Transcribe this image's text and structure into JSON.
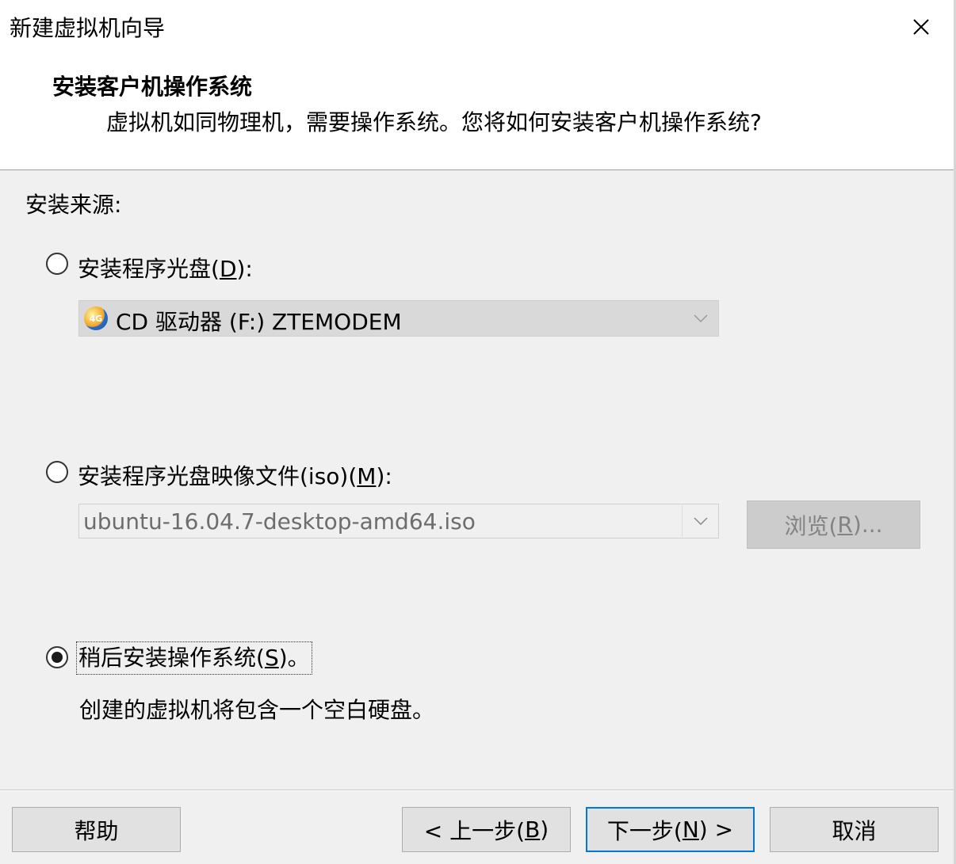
{
  "window": {
    "title": "新建虚拟机向导"
  },
  "header": {
    "title": "安装客户机操作系统",
    "subtitle": "虚拟机如同物理机，需要操作系统。您将如何安装客户机操作系统?"
  },
  "source_label": "安装来源:",
  "options": {
    "disc": {
      "label_pre": "安装程序光盘(",
      "mnemonic": "D",
      "label_post": "):",
      "selected": false,
      "drive_icon_text": "4G",
      "drive_value": "CD 驱动器 (F:) ZTEMODEM"
    },
    "iso": {
      "label_pre": "安装程序光盘映像文件(iso)(",
      "mnemonic": "M",
      "label_post": "):",
      "selected": false,
      "path_value": "ubuntu-16.04.7-desktop-amd64.iso",
      "browse_pre": "浏览(",
      "browse_mnemonic": "R",
      "browse_post": ")..."
    },
    "later": {
      "label_pre": "稍后安装操作系统(",
      "mnemonic": "S",
      "label_post": ")。",
      "selected": true,
      "description": "创建的虚拟机将包含一个空白硬盘。"
    }
  },
  "buttons": {
    "help": "帮助",
    "back_pre": "< 上一步(",
    "back_mnemonic": "B",
    "back_post": ")",
    "next_pre": "下一步(",
    "next_mnemonic": "N",
    "next_post": ") >",
    "cancel": "取消"
  },
  "icons": {
    "close": "close-icon",
    "dropdown": "chevron-down-icon",
    "drive": "cd-drive-icon"
  }
}
